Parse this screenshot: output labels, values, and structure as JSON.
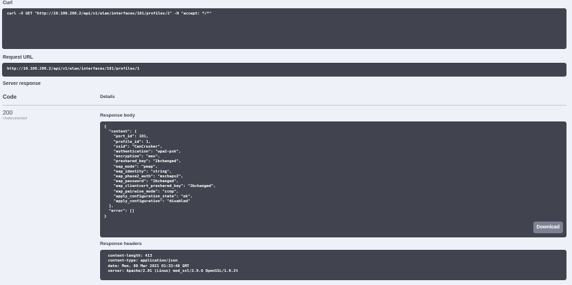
{
  "curl": {
    "label": "Curl",
    "command": "curl -X GET \"http://10.100.200.2/api/v1/wlan/interfaces/101/profiles/1\" -H \"accept: */*\""
  },
  "request_url": {
    "label": "Request URL",
    "value": "http://10.100.200.2/api/v1/wlan/interfaces/101/profiles/1"
  },
  "server_response": {
    "label": "Server response",
    "col_code": "Code",
    "col_details": "Details",
    "code": "200",
    "code_note": "Undocumented",
    "body_label": "Response body",
    "body_text": "{\n  \"content\": {\n    \"port_id\": 101,\n    \"profile_id\": 1,\n    \"ssid\": \"CanCrusher\",\n    \"authentication\": \"wpa2-psk\",\n    \"encryption\": \"aes\",\n    \"preshared_key\": \"2bchanged\",\n    \"eap_mode\": \"peap\",\n    \"eap_identity\": \"string\",\n    \"eap_phase2_auth\": \"mschapv2\",\n    \"eap_password\": \"2bchanged\",\n    \"eap_clientcert_preshared_key\": \"2bchanged\",\n    \"eap_pairwise_mode\": \"ccmp\",\n    \"apply_configuration_state\": \"ok\",\n    \"apply_configuration\": \"disabled\"\n  },\n  \"error\": []\n}",
    "download_label": "Download",
    "headers_label": "Response headers",
    "headers_text": " content-length: 413\n content-type: application/json\n date: Mon, 08 Mar 2021 01:33:48 GMT\n server: Apache/2.01 (Linux) mod_ssl/2.9.6 OpenSSL/1.0.2t"
  }
}
